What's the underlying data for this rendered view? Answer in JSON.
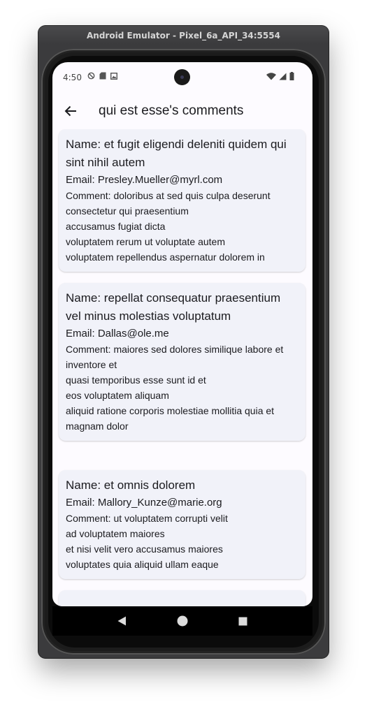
{
  "window": {
    "title": "Android Emulator - Pixel_6a_API_34:5554"
  },
  "status_bar": {
    "time": "4:50",
    "icons_left": [
      "shield-icon",
      "sd-card-icon",
      "image-icon"
    ],
    "icons_right": [
      "wifi-icon",
      "cell-signal-icon",
      "battery-icon"
    ]
  },
  "app_bar": {
    "title": "qui est esse's comments",
    "back_icon": "arrow-back-icon"
  },
  "comments": [
    {
      "name": "Name: et fugit eligendi deleniti quidem qui sint nihil autem",
      "email": "Email: Presley.Mueller@myrl.com",
      "comment": "Comment: doloribus at sed quis culpa deserunt consectetur qui praesentium\naccusamus fugiat dicta\nvoluptatem rerum ut voluptate autem\nvoluptatem repellendus aspernatur dolorem in"
    },
    {
      "name": "Name: repellat consequatur praesentium vel minus molestias voluptatum",
      "email": "Email: Dallas@ole.me",
      "comment": "Comment: maiores sed dolores similique labore et inventore et\nquasi temporibus esse sunt id et\neos voluptatem aliquam\naliquid ratione corporis molestiae mollitia quia et magnam dolor"
    },
    {
      "name": "Name: et omnis dolorem",
      "email": "Email: Mallory_Kunze@marie.org",
      "comment": "Comment: ut voluptatem corrupti velit\nad voluptatem maiores\net nisi velit vero accusamus maiores\nvoluptates quia aliquid ullam eaque"
    }
  ],
  "nav_bar": {
    "buttons": [
      "back-triangle-icon",
      "home-circle-icon",
      "recents-square-icon"
    ]
  },
  "colors": {
    "card_background": "#f1f2f9",
    "screen_background": "#fdfbff",
    "text": "#1b1b1f"
  }
}
